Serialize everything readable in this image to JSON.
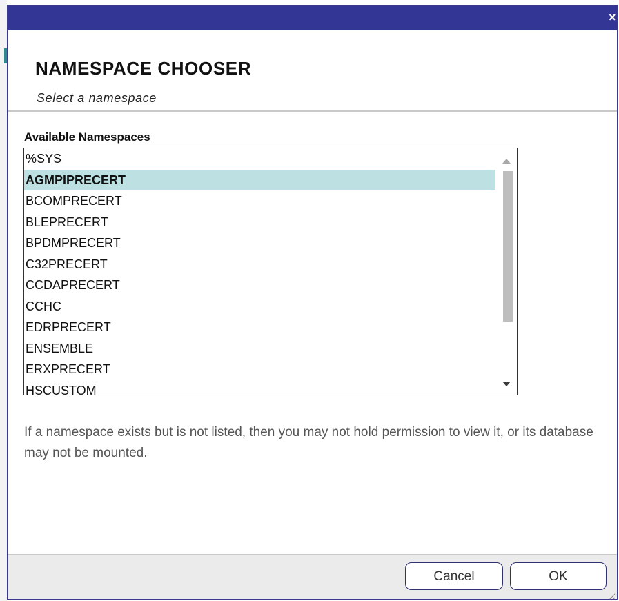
{
  "dialog": {
    "close_glyph": "×",
    "title": "NAMESPACE CHOOSER",
    "subtitle": "Select a namespace",
    "list_label": "Available Namespaces",
    "namespaces": [
      "%SYS",
      "AGMPIPRECERT",
      "BCOMPRECERT",
      "BLEPRECERT",
      "BPDMPRECERT",
      "C32PRECERT",
      "CCDAPRECERT",
      "CCHC",
      "EDRPRECERT",
      "ENSEMBLE",
      "ERXPRECERT",
      "HSCUSTOM"
    ],
    "selected_namespace": "AGMPIPRECERT",
    "info_text": "If a namespace exists but is not listed, then you may not hold permission to view it, or its database may not be mounted.",
    "cancel_label": "Cancel",
    "ok_label": "OK"
  },
  "colors": {
    "titlebar": "#333695",
    "selected_row": "#bde1e2",
    "footer": "#ebebeb"
  }
}
